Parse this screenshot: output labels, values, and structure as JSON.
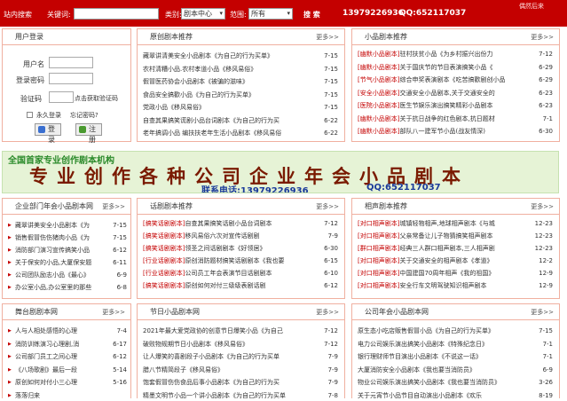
{
  "topbar": {
    "search_label": "站内搜索",
    "keyword_label": "关键词:",
    "category_label": "类别:",
    "category_value": "剧本中心",
    "scope_label": "范围:",
    "scope_value": "所有",
    "search_button": "搜 索",
    "phone": "13979226936",
    "qq": "QQ:652117037",
    "logo_text": "偶然后来"
  },
  "login": {
    "title": "用户登录",
    "username_label": "用户名",
    "password_label": "登录密码",
    "captcha_label": "验证码",
    "captcha_link": "点击获取验证码",
    "remember_label": "永久登录",
    "forgot_label": "忘记密码?",
    "login_button": "登录",
    "register_button": "注册"
  },
  "more": "更多>>",
  "boxes": {
    "original": {
      "title": "原创剧本推荐",
      "rows": [
        {
          "t": "藏翠讲清美安全小品剧本《为自己的行为买单》",
          "n": "7-15"
        },
        {
          "t": "农村清糟小品.农村孝道小品《移风易俗》",
          "n": "7-15"
        },
        {
          "t": "假冒医药协会小品剧本《被骗的滋味》",
          "n": "7-15"
        },
        {
          "t": "食品安全搞歡小品《为自己的行为买单》",
          "n": "7-15"
        },
        {
          "t": "党政小品《移风易俗》",
          "n": "7-15"
        },
        {
          "t": "自查其果搞笑谎剧小品台词剧本《为自己的行为买",
          "n": "6-22"
        },
        {
          "t": "老年搞调小品 编扶扶老年生活小品剧本《移风易俗",
          "n": "6-22"
        }
      ]
    },
    "skit": {
      "title": "小品剧本推荐",
      "rows": [
        {
          "t": "[幽默小品剧本]驻村扶贫小品《为乡村振兴出份力",
          "n": "7-12"
        },
        {
          "t": "[幽默小品剧本]关于国庆节的节目表演搞笑小品《",
          "n": "6-29"
        },
        {
          "t": "[节气小品剧本]综合申奖表演剧本《吃苦搞歡剧创小品",
          "n": "6-29"
        },
        {
          "t": "[安全小品剧本]交通安全小品剧本,关于交通安全的",
          "n": "6-23"
        },
        {
          "t": "[医院小品剧本]医生节娱乐演出搞笑精彩小品剧本",
          "n": "6-23"
        },
        {
          "t": "[幽默小品剧本]关于抗日战争的红色剧本,抗日题材",
          "n": "7-1"
        },
        {
          "t": "[幽默小品剧本]部队八一建军节小品(战友情深)",
          "n": "6-30"
        }
      ]
    },
    "enterprise": {
      "title": "企业部门年会小品剧本网",
      "rows": [
        {
          "t": "藏翠讲美安全小品剧本《为",
          "n": "7-15"
        },
        {
          "t": "销售假冒伤伤猪肉小品《为",
          "n": "7-15"
        },
        {
          "t": "消防部门演习宣传搞笑小品",
          "n": "6-12"
        },
        {
          "t": "关于保安的小品,大厦保安题",
          "n": "6-11"
        },
        {
          "t": "公司团队励志小品《最心》",
          "n": "6-9"
        },
        {
          "t": "办公室小品,办公室里的那些",
          "n": "6-8"
        }
      ]
    },
    "funny": {
      "title": "话剧剧本推荐",
      "rows": [
        {
          "t": "[搞笑话剧剧本]自查其果搞笑话剧小品台词剧本",
          "n": "7-12"
        },
        {
          "t": "[搞笑话剧剧本]移风易俗六次对宣传话剧剧",
          "n": "7-9"
        },
        {
          "t": "[搞笑话剧剧本]领圣之间话剧剧本《好领居》",
          "n": "6-30"
        },
        {
          "t": "[行业话剧剧本]原创消防题材搞笑话剧剧本《我也要",
          "n": "6-15"
        },
        {
          "t": "[行业话剧剧本]公司员工年会表演节目话剧剧本",
          "n": "6-10"
        },
        {
          "t": "[搞笑话剧剧本]原创如何对付三级级表剧话剧",
          "n": "6-12"
        }
      ]
    },
    "crosstalk": {
      "title": "相声剧本推荐",
      "rows": [
        {
          "t": "[对口相声剧本]城镇轻物相声,地球相声剧本《与城",
          "n": "12-23"
        },
        {
          "t": "[对口相声剧本]父亲常备让儿子物猜搞笑相声剧本",
          "n": "12-23"
        },
        {
          "t": "[群口相声剧本]经典三人群口相声剧本,三人相声剧",
          "n": "12-23"
        },
        {
          "t": "[对口相声剧本]关于交通安全的相声剧本《孝道》",
          "n": "12-2"
        },
        {
          "t": "[对口相声剧本]中国建国70周年相声《我的祖国》",
          "n": "12-9"
        },
        {
          "t": "[对口相声剧本]安全行车文明驾驶知识相声剧本",
          "n": "12-9"
        }
      ]
    },
    "stage": {
      "title": "舞台剧剧本网",
      "rows": [
        {
          "t": "人与人相处感悟的心理",
          "n": "7-4"
        },
        {
          "t": "消防训练演习心理剧,消",
          "n": "6-17"
        },
        {
          "t": "公司部门员工之间心理",
          "n": "6-12"
        },
        {
          "t": "《八场歌剧》最后一段",
          "n": "5-14"
        },
        {
          "t": "原创如何对付小三心理",
          "n": "5-16"
        },
        {
          "t": "落落归来",
          "n": ""
        }
      ]
    },
    "festival": {
      "title": "节日小品剧本网",
      "rows": [
        {
          "t": "2021年最大爱党政协的创意节日爆笑小品《为自己",
          "n": "7-12"
        },
        {
          "t": "破败物规期节日小品剧本《移风易俗》",
          "n": "7-12"
        },
        {
          "t": "让人爆笑的喜剧段子小品剧本《为自己的行为买单",
          "n": "7-9"
        },
        {
          "t": "腊八节精简段子《移风易俗》",
          "n": "7-9"
        },
        {
          "t": "饱套假冒伤伤食品后事小品剧本《为自己的行为买",
          "n": "7-9"
        },
        {
          "t": "精墨文明节小品一个讲小品剧本《为自己的行为买单",
          "n": "7-8"
        }
      ]
    },
    "annual": {
      "title": "公司年会小品剧本网",
      "rows": [
        {
          "t": "原生态小吃店贩售假冒小品《为自己的行为买单》",
          "n": "7-15"
        },
        {
          "t": "电力公司娱乐演出搞笑小品剧本《特殊纪念日》",
          "n": "7-1"
        },
        {
          "t": "银行理财师节目演出小品剧本《不说这一话》",
          "n": "7-1"
        },
        {
          "t": "大厦消防安全小品剧本《我也要当消防员》",
          "n": "6-9"
        },
        {
          "t": "物业公司娱乐演出搞笑小品剧本《我也要当消防员》",
          "n": "3-26"
        },
        {
          "t": "关于元宵节小品节目自动演出小品剧本《欢乐",
          "n": "8-19"
        }
      ]
    }
  },
  "banner": {
    "line1": "全国首家专业创作剧本机构",
    "line2": "专业创作各种公司企业年会小品剧本",
    "line3": "联系电话:13979226936",
    "line4": "QQ:652117037"
  }
}
